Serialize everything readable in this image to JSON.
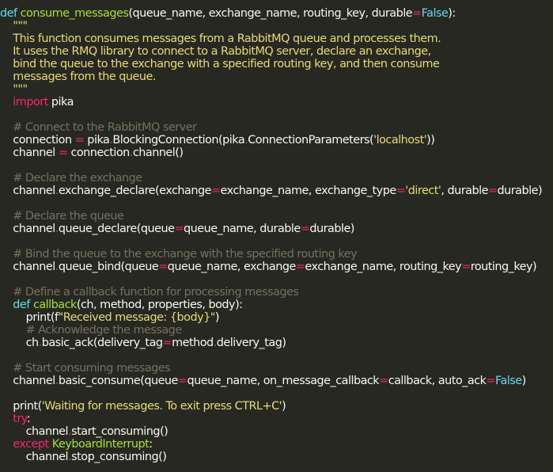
{
  "colors": {
    "background": "#272822",
    "text": "#f8f8f2",
    "keyword": "#66d9ef",
    "import_keyword": "#f92672",
    "function_name": "#a6e22e",
    "string": "#e6db74",
    "comment": "#75715e",
    "operator": "#f92672",
    "builtin": "#a6e22e"
  },
  "code_lines": [
    [
      [
        "kw",
        "def "
      ],
      [
        "fn",
        "consume_messages"
      ],
      [
        "tx",
        "(queue_name, exchange_name, routing_key, durable"
      ],
      [
        "op",
        "="
      ],
      [
        "kw",
        "False"
      ],
      [
        "tx",
        "):"
      ]
    ],
    [
      [
        "str",
        "    \"\"\""
      ]
    ],
    [
      [
        "str",
        "    This function consumes messages from a RabbitMQ queue and processes them."
      ]
    ],
    [
      [
        "str",
        "    It uses the RMQ library to connect to a RabbitMQ server, declare an exchange,"
      ]
    ],
    [
      [
        "str",
        "    bind the queue to the exchange with a specified routing key, and then consume"
      ]
    ],
    [
      [
        "str",
        "    messages from the queue."
      ]
    ],
    [
      [
        "str",
        "    \"\"\""
      ]
    ],
    [
      [
        "kw2",
        "    import"
      ],
      [
        "tx",
        " pika"
      ]
    ],
    [
      [
        "tx",
        ""
      ]
    ],
    [
      [
        "cm",
        "    # Connect to the RabbitMQ server"
      ]
    ],
    [
      [
        "tx",
        "    connection "
      ],
      [
        "op",
        "="
      ],
      [
        "tx",
        " pika"
      ],
      [
        "op",
        "."
      ],
      [
        "tx",
        "BlockingConnection(pika"
      ],
      [
        "op",
        "."
      ],
      [
        "tx",
        "ConnectionParameters("
      ],
      [
        "str",
        "'localhost'"
      ],
      [
        "tx",
        "))"
      ]
    ],
    [
      [
        "tx",
        "    channel "
      ],
      [
        "op",
        "="
      ],
      [
        "tx",
        " connection"
      ],
      [
        "op",
        "."
      ],
      [
        "tx",
        "channel()"
      ]
    ],
    [
      [
        "tx",
        ""
      ]
    ],
    [
      [
        "cm",
        "    # Declare the exchange"
      ]
    ],
    [
      [
        "tx",
        "    channel"
      ],
      [
        "op",
        "."
      ],
      [
        "tx",
        "exchange_declare(exchange"
      ],
      [
        "op",
        "="
      ],
      [
        "tx",
        "exchange_name, exchange_type"
      ],
      [
        "op",
        "="
      ],
      [
        "str",
        "'direct'"
      ],
      [
        "tx",
        ", durable"
      ],
      [
        "op",
        "="
      ],
      [
        "tx",
        "durable)"
      ]
    ],
    [
      [
        "tx",
        ""
      ]
    ],
    [
      [
        "cm",
        "    # Declare the queue"
      ]
    ],
    [
      [
        "tx",
        "    channel"
      ],
      [
        "op",
        "."
      ],
      [
        "tx",
        "queue_declare(queue"
      ],
      [
        "op",
        "="
      ],
      [
        "tx",
        "queue_name, durable"
      ],
      [
        "op",
        "="
      ],
      [
        "tx",
        "durable)"
      ]
    ],
    [
      [
        "tx",
        ""
      ]
    ],
    [
      [
        "cm",
        "    # Bind the queue to the exchange with the specified routing key"
      ]
    ],
    [
      [
        "tx",
        "    channel"
      ],
      [
        "op",
        "."
      ],
      [
        "tx",
        "queue_bind(queue"
      ],
      [
        "op",
        "="
      ],
      [
        "tx",
        "queue_name, exchange"
      ],
      [
        "op",
        "="
      ],
      [
        "tx",
        "exchange_name, routing_key"
      ],
      [
        "op",
        "="
      ],
      [
        "tx",
        "routing_key)"
      ]
    ],
    [
      [
        "tx",
        ""
      ]
    ],
    [
      [
        "cm",
        "    # Define a callback function for processing messages"
      ]
    ],
    [
      [
        "kw",
        "    def "
      ],
      [
        "fn",
        "callback"
      ],
      [
        "tx",
        "(ch, method, properties, body):"
      ]
    ],
    [
      [
        "tx",
        "        print(f"
      ],
      [
        "str",
        "\"Received message: {body}\""
      ],
      [
        "tx",
        ")"
      ]
    ],
    [
      [
        "cm",
        "        # Acknowledge the message"
      ]
    ],
    [
      [
        "tx",
        "        ch"
      ],
      [
        "op",
        "."
      ],
      [
        "tx",
        "basic_ack(delivery_tag"
      ],
      [
        "op",
        "="
      ],
      [
        "tx",
        "method"
      ],
      [
        "op",
        "."
      ],
      [
        "tx",
        "delivery_tag)"
      ]
    ],
    [
      [
        "tx",
        ""
      ]
    ],
    [
      [
        "cm",
        "    # Start consuming messages"
      ]
    ],
    [
      [
        "tx",
        "    channel"
      ],
      [
        "op",
        "."
      ],
      [
        "tx",
        "basic_consume(queue"
      ],
      [
        "op",
        "="
      ],
      [
        "tx",
        "queue_name, on_message_callback"
      ],
      [
        "op",
        "="
      ],
      [
        "tx",
        "callback, auto_ack"
      ],
      [
        "op",
        "="
      ],
      [
        "kw",
        "False"
      ],
      [
        "tx",
        ")"
      ]
    ],
    [
      [
        "tx",
        ""
      ]
    ],
    [
      [
        "tx",
        "    print("
      ],
      [
        "str",
        "'Waiting for messages. To exit press CTRL+C'"
      ],
      [
        "tx",
        ")"
      ]
    ],
    [
      [
        "kw2",
        "    try"
      ],
      [
        "tx",
        ":"
      ]
    ],
    [
      [
        "tx",
        "        channel"
      ],
      [
        "op",
        "."
      ],
      [
        "tx",
        "start_consuming()"
      ]
    ],
    [
      [
        "kw2",
        "    except "
      ],
      [
        "bi",
        "KeyboardInterrupt"
      ],
      [
        "tx",
        ":"
      ]
    ],
    [
      [
        "tx",
        "        channel"
      ],
      [
        "op",
        "."
      ],
      [
        "tx",
        "stop_consuming()"
      ]
    ]
  ]
}
